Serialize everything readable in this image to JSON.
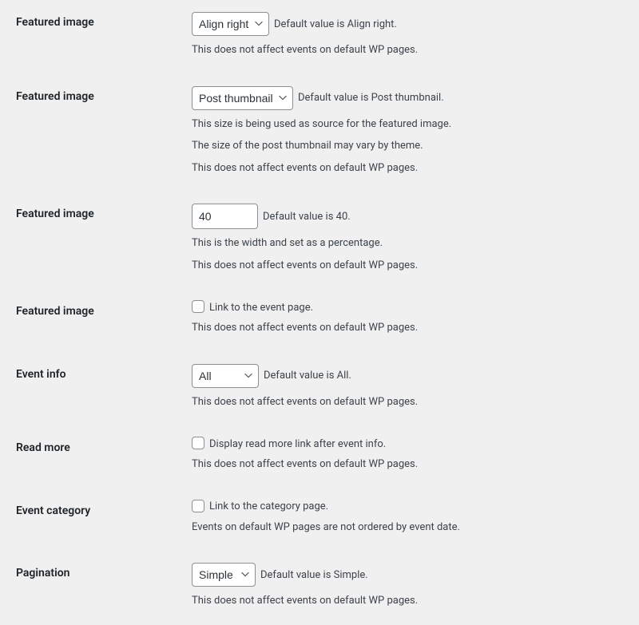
{
  "rows": {
    "align": {
      "label": "Featured image",
      "selected": "Align right",
      "hint": "Default value is Align right.",
      "desc1": "This does not affect events on default WP pages."
    },
    "size": {
      "label": "Featured image",
      "selected": "Post thumbnail",
      "hint": "Default value is Post thumbnail.",
      "desc1": "This size is being used as source for the featured image.",
      "desc2": "The size of the post thumbnail may vary by theme.",
      "desc3": "This does not affect events on default WP pages."
    },
    "width": {
      "label": "Featured image",
      "value": "40",
      "hint": "Default value is 40.",
      "desc1": "This is the width and set as a percentage.",
      "desc2": "This does not affect events on default WP pages."
    },
    "link": {
      "label": "Featured image",
      "checkbox_label": "Link to the event page.",
      "desc1": "This does not affect events on default WP pages."
    },
    "eventinfo": {
      "label": "Event info",
      "selected": "All",
      "hint": "Default value is All.",
      "desc1": "This does not affect events on default WP pages."
    },
    "readmore": {
      "label": "Read more",
      "checkbox_label": "Display read more link after event info.",
      "desc1": "This does not affect events on default WP pages."
    },
    "category": {
      "label": "Event category",
      "checkbox_label": "Link to the category page.",
      "desc1": "Events on default WP pages are not ordered by event date."
    },
    "pagination": {
      "label": "Pagination",
      "selected": "Simple",
      "hint": "Default value is Simple.",
      "desc1": "This does not affect events on default WP pages."
    }
  }
}
